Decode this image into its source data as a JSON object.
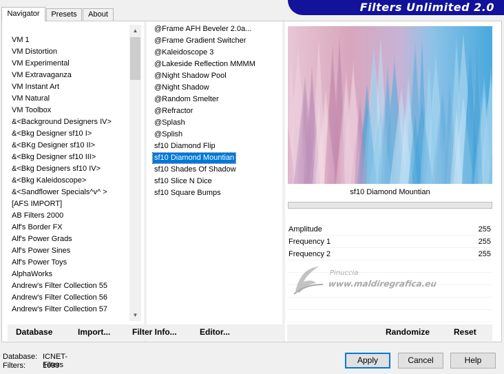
{
  "tabs": [
    "Navigator",
    "Presets",
    "About"
  ],
  "banner": {
    "title": "Filters Unlimited 2.0"
  },
  "categories": [
    "VM 1",
    "VM Distortion",
    "VM Experimental",
    "VM Extravaganza",
    "VM Instant Art",
    "VM Natural",
    "VM Toolbox",
    "&<Background Designers IV>",
    "&<Bkg Designer sf10 I>",
    "&<BKg Designer sf10 II>",
    "&<Bkg Designer sf10 III>",
    "&<Bkg Designers sf10 IV>",
    "&<Bkg Kaleidoscope>",
    "&<Sandflower Specials^v^ >",
    "[AFS IMPORT]",
    "AB Filters 2000",
    "Alf's Border FX",
    "Alf's Power Grads",
    "Alf's Power Sines",
    "Alf's Power Toys",
    "AlphaWorks",
    "Andrew's Filter Collection 55",
    "Andrew's Filter Collection 56",
    "Andrew's Filter Collection 57"
  ],
  "filters": [
    "@Frame AFH Beveler 2.0a...",
    "@Frame Gradient Switcher",
    "@Kaleidoscope 3",
    "@Lakeside Reflection MMMM",
    "@Night Shadow Pool",
    "@Night Shadow",
    "@Random Smelter",
    "@Refractor",
    "@Splash",
    "@Splish",
    "sf10 Diamond Flip",
    "sf10 Diamond Mountian",
    "sf10 Shades Of Shadow",
    "sf10 Slice N Dice",
    "sf10 Square Bumps"
  ],
  "selected_filter_index": 11,
  "preview": {
    "name": "sf10 Diamond Mountian"
  },
  "params": [
    {
      "name": "Amplitude",
      "value": "255"
    },
    {
      "name": "Frequency 1",
      "value": "255"
    },
    {
      "name": "Frequency 2",
      "value": "255"
    }
  ],
  "watermark": {
    "name": "Pinuccia",
    "url": "www.maldiregrafica.eu"
  },
  "bottom_buttons": {
    "database": "Database",
    "import": "Import...",
    "filter_info": "Filter Info...",
    "editor": "Editor...",
    "randomize": "Randomize",
    "reset": "Reset"
  },
  "status": {
    "database_label": "Database:",
    "database_value": "ICNET-Filters",
    "filters_label": "Filters:",
    "filters_value": "1099"
  },
  "dialog_buttons": {
    "apply": "Apply",
    "cancel": "Cancel",
    "help": "Help"
  },
  "colors": {
    "banner": "#12129a",
    "selection": "#0078d7"
  }
}
